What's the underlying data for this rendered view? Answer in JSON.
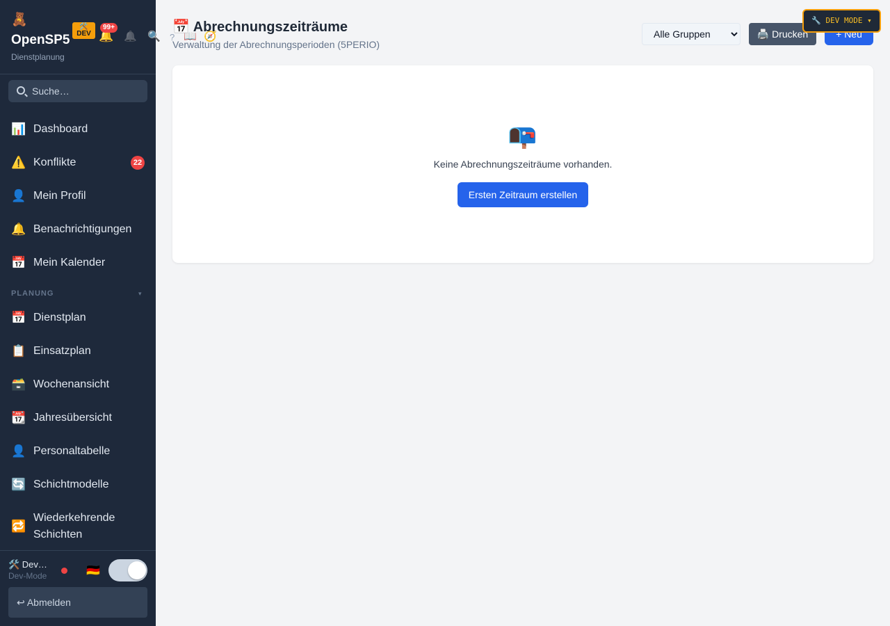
{
  "app": {
    "logo_emoji": "🧸",
    "name": "OpenSP5",
    "subtitle": "Dienstplanung",
    "dev_badge_icon": "🛠️",
    "dev_badge_label": "DEV",
    "notification_count": "99+"
  },
  "header_icons": {
    "bell": "🔔",
    "bell_outline": "🔔",
    "search": "🔍",
    "help": "?",
    "manual": "📖",
    "compass": "🧭"
  },
  "search": {
    "placeholder": "Suche…"
  },
  "nav": {
    "top_items": [
      {
        "icon": "📊",
        "label": "Dashboard"
      },
      {
        "icon": "⚠️",
        "label": "Konflikte",
        "count": "22"
      },
      {
        "icon": "👤",
        "label": "Mein Profil"
      },
      {
        "icon": "🔔",
        "label": "Benachrichtigungen"
      },
      {
        "icon": "📅",
        "label": "Mein Kalender"
      }
    ],
    "section_planung": "PLANUNG",
    "section_caret": "▾",
    "planung_items": [
      {
        "icon": "📅",
        "label": "Dienstplan"
      },
      {
        "icon": "📋",
        "label": "Einsatzplan"
      },
      {
        "icon": "🗃️",
        "label": "Wochenansicht"
      },
      {
        "icon": "📆",
        "label": "Jahresübersicht"
      },
      {
        "icon": "👤",
        "label": "Personaltabelle"
      },
      {
        "icon": "🔄",
        "label": "Schichtmodelle"
      },
      {
        "icon": "🔁",
        "label": "Wiederkehrende Schichten"
      }
    ]
  },
  "footer": {
    "user_name": "🛠️ Dev…",
    "user_role": "Dev-Mode",
    "flag": "🇩🇪",
    "logout": "↩ Abmelden"
  },
  "page": {
    "title_icon": "📅",
    "title": "Abrechnungszeiträume",
    "subtitle": "Verwaltung der Abrechnungsperioden (5PERIO)",
    "group_filter": "Alle Gruppen",
    "print_button": "🖨️ Drucken",
    "new_button": "+ Neu",
    "dev_mode_button": "🔧 DEV MODE ▾"
  },
  "empty_state": {
    "icon": "📭",
    "message": "Keine Abrechnungszeiträume vorhanden.",
    "action": "Ersten Zeitraum erstellen"
  }
}
